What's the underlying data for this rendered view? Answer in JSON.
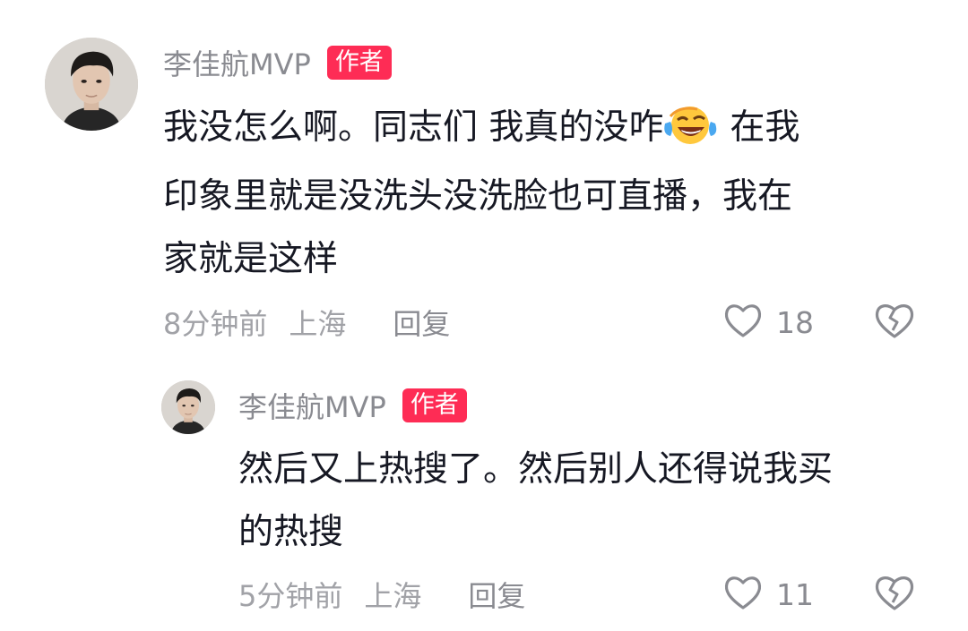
{
  "comments": [
    {
      "author": "李佳航MVP",
      "badge": "作者",
      "text_lines": [
        "我没怎么啊。同志们 我真的没咋",
        "在我",
        "印象里就是没洗头没洗脸也可直播，我在",
        "家就是这样"
      ],
      "emoji": "face-with-tears-of-joy",
      "time": "8分钟前",
      "location": "上海",
      "reply_label": "回复",
      "likes": "18",
      "avatar_icon": "avatar-photo"
    },
    {
      "author": "李佳航MVP",
      "badge": "作者",
      "text_lines": [
        "然后又上热搜了。然后别人还得说我买",
        "的热搜"
      ],
      "time": "5分钟前",
      "location": "上海",
      "reply_label": "回复",
      "likes": "11",
      "avatar_icon": "avatar-photo"
    }
  ],
  "icons": {
    "like": "heart-outline-icon",
    "dislike": "broken-heart-icon"
  },
  "colors": {
    "badge_bg": "#fe2c55",
    "meta": "#a1a2a7",
    "name": "#8a8b91"
  }
}
